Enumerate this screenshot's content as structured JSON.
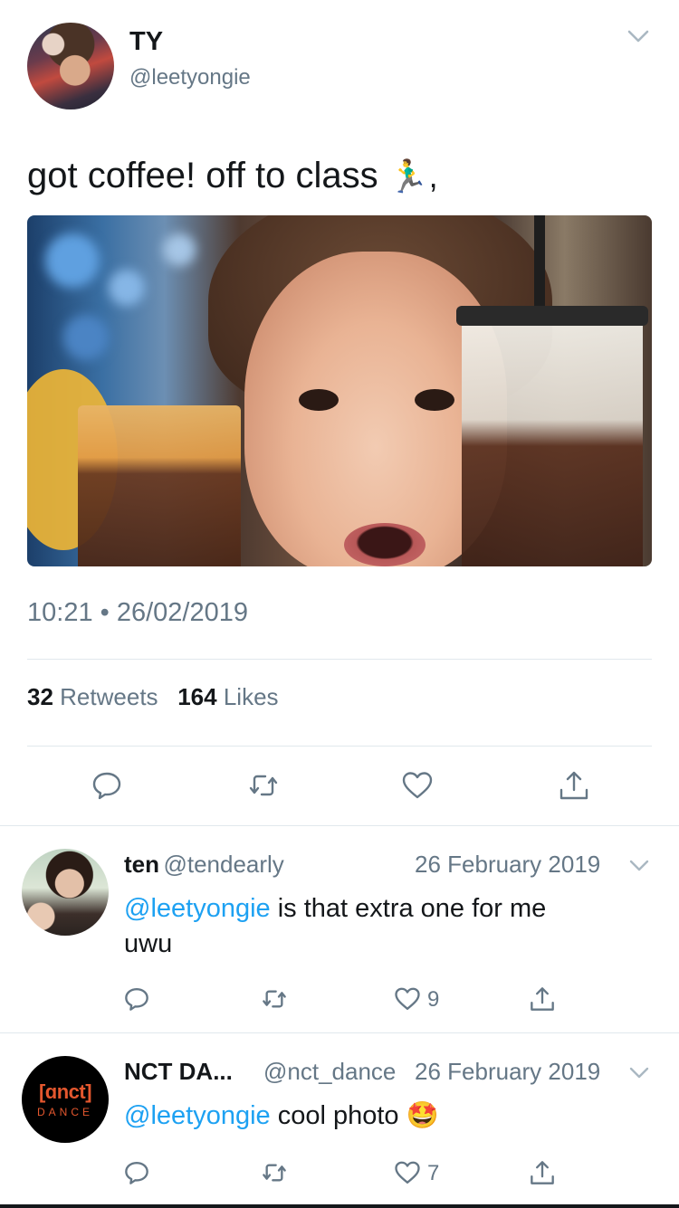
{
  "tweet": {
    "display_name": "TY",
    "handle": "@leetyongie",
    "text": "got coffee! off to class",
    "text_emoji": "🏃‍♂️,",
    "time": "10:21",
    "separator": "•",
    "date": "26/02/2019",
    "retweets_count": "32",
    "retweets_label": "Retweets",
    "likes_count": "164",
    "likes_label": "Likes"
  },
  "replies": [
    {
      "display_name": "ten",
      "handle": "@tendearly",
      "date": "26 February 2019",
      "mention": "@leetyongie",
      "text_line1": " is that extra one for me",
      "text_line2": "uwu",
      "likes": "9"
    },
    {
      "display_name": "NCT DA...",
      "handle": "@nct_dance",
      "date": "26 February 2019",
      "mention": "@leetyongie",
      "text": " cool photo",
      "emoji": "🤩",
      "likes": "7",
      "avatar_logo_text": "[ɑnct]",
      "avatar_sub_text": "DANCE"
    }
  ],
  "colors": {
    "link": "#1da1f2",
    "secondary_text": "#657786",
    "primary_text": "#14171a",
    "divider": "#e1e8ed",
    "icon": "#657786"
  },
  "icons": {
    "reply": "reply-icon",
    "retweet": "retweet-icon",
    "like": "heart-icon",
    "share": "share-icon",
    "menu": "chevron-down-icon"
  }
}
